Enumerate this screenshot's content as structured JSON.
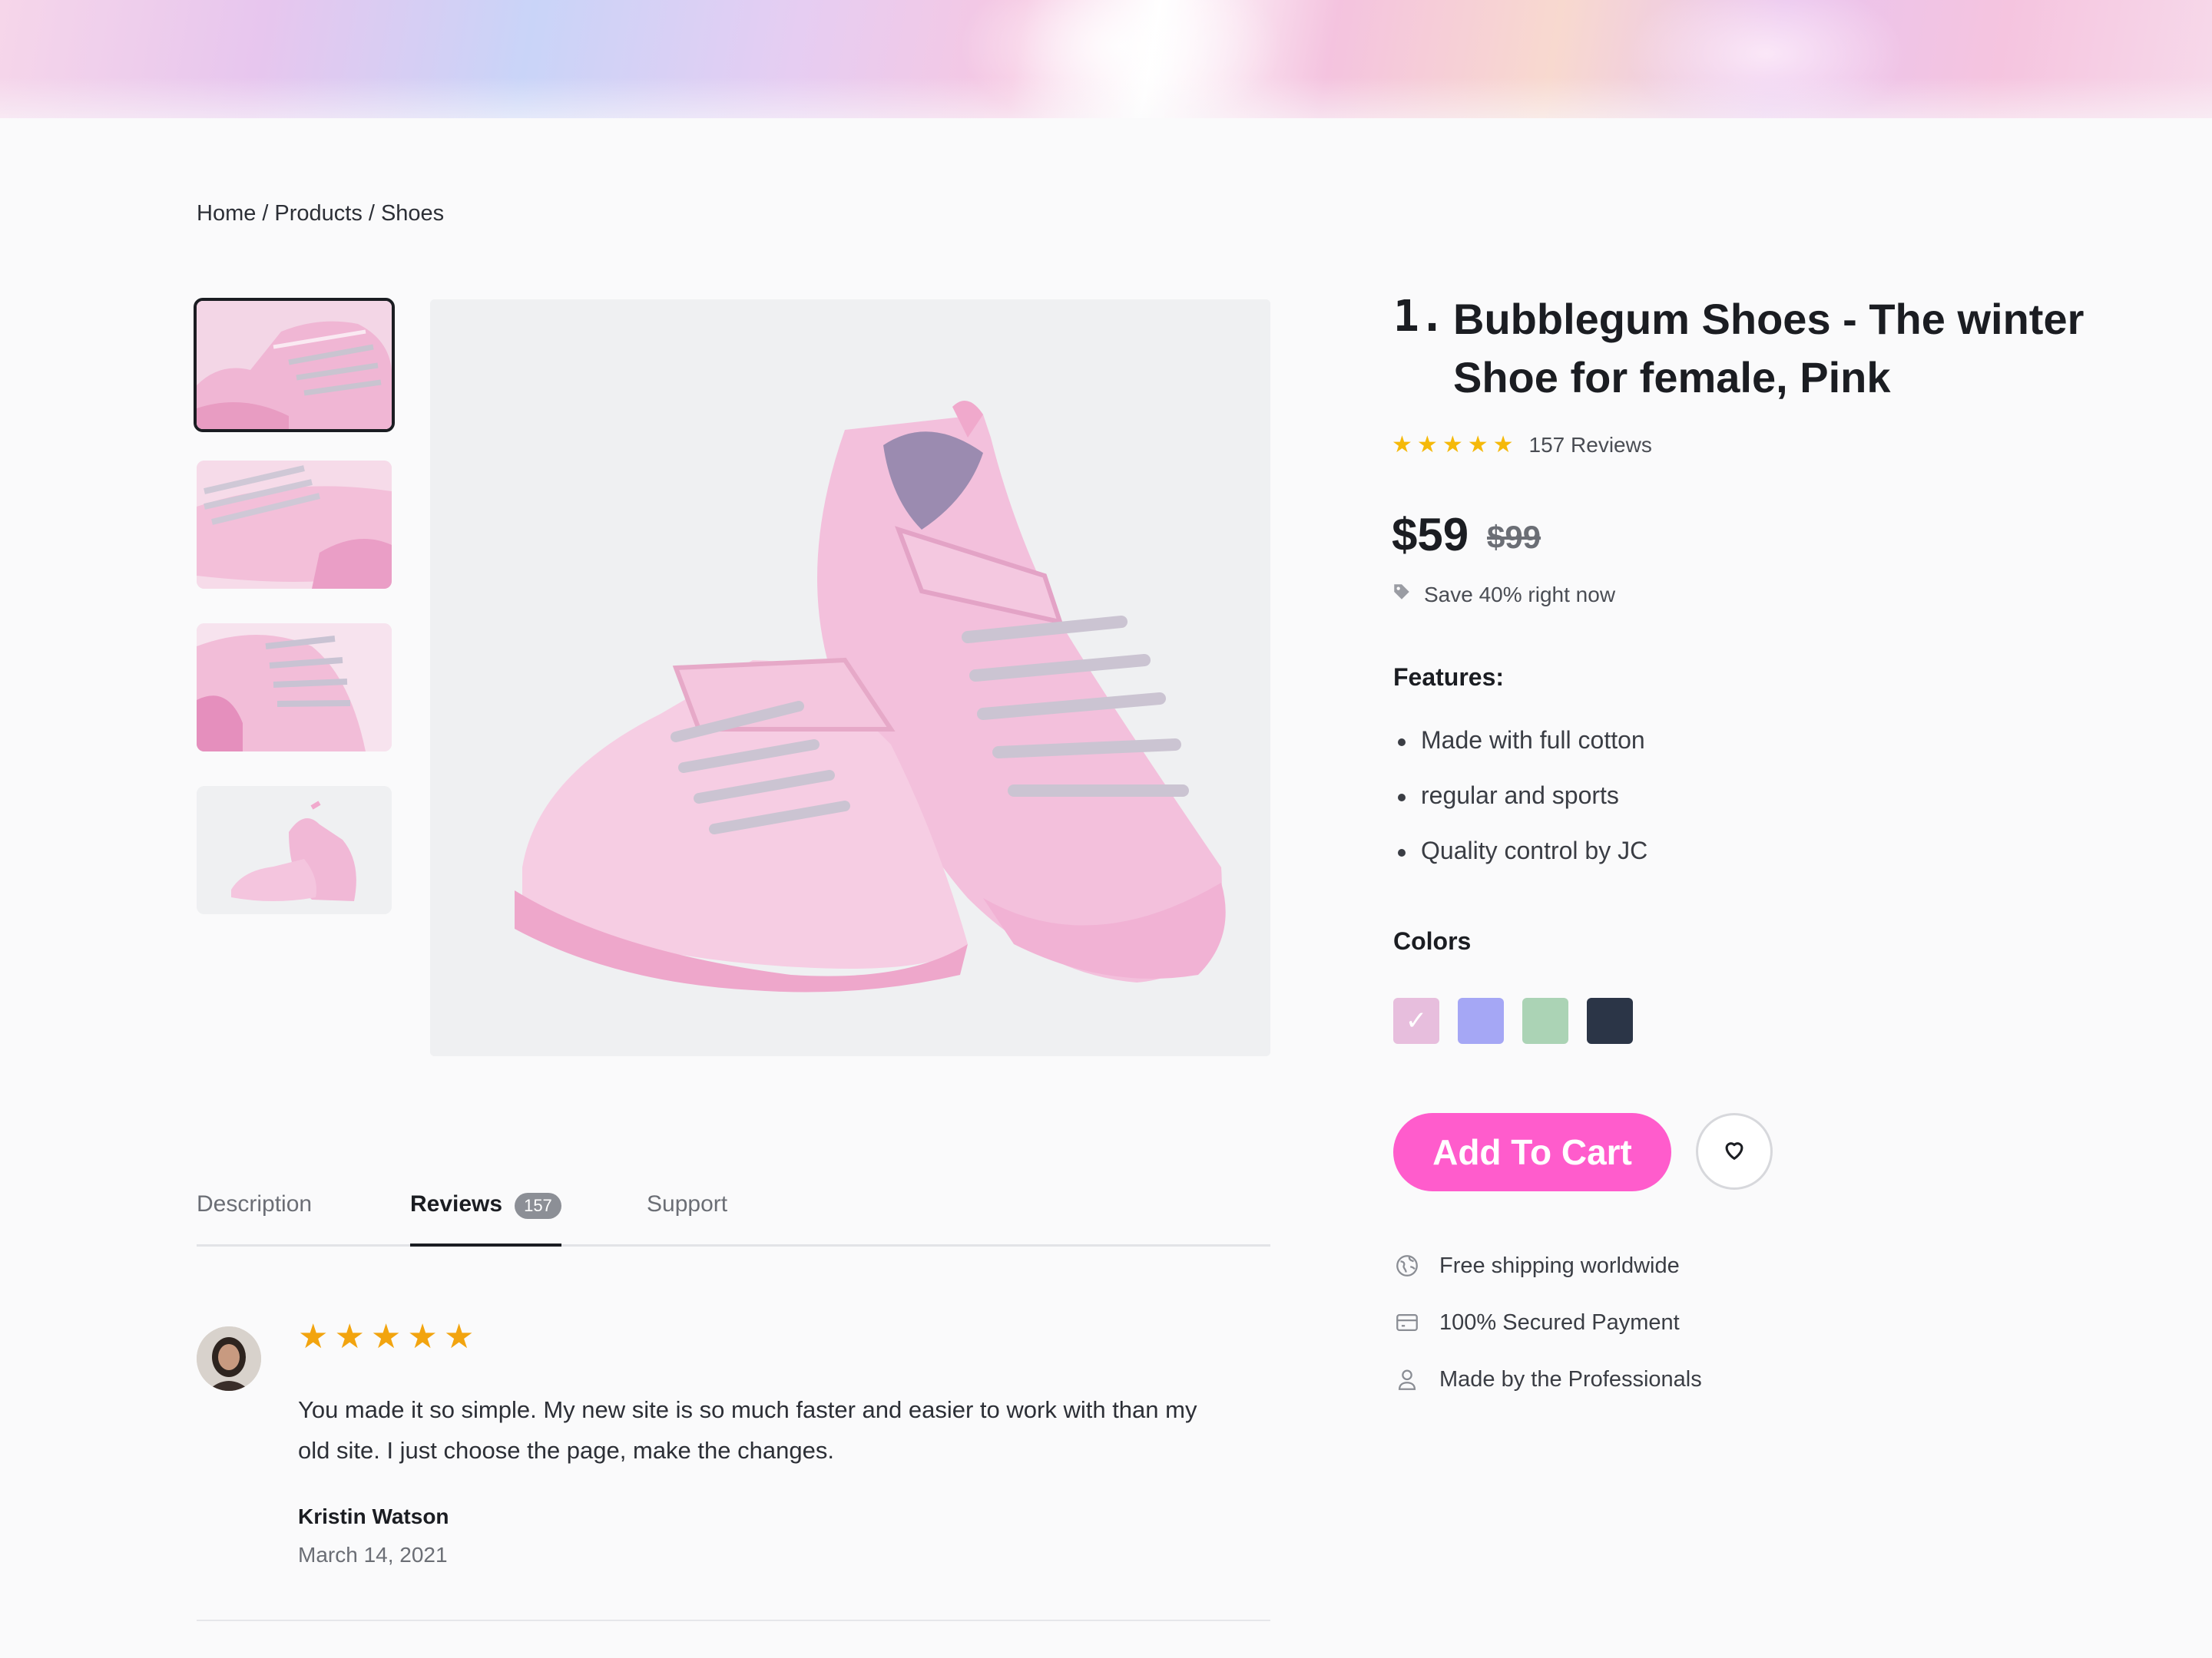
{
  "breadcrumb": [
    "Home",
    "Products",
    "Shoes"
  ],
  "product": {
    "number": "1.",
    "title": "Bubblegum Shoes - The winter Shoe for female, Pink",
    "rating_stars": 5,
    "reviews_label": "157 Reviews",
    "price": "$59",
    "old_price": "$99",
    "save_text": "Save 40% right now",
    "features_heading": "Features:",
    "features": [
      "Made with full cotton",
      "regular and sports",
      "Quality control by JC"
    ],
    "colors_heading": "Colors",
    "colors": [
      "#e7bedd",
      "#a5a7f5",
      "#abd3b5",
      "#2b3547"
    ],
    "selected_color_index": 0,
    "add_to_cart_label": "Add To Cart",
    "perks": [
      "Free shipping worldwide",
      "100% Secured Payment",
      "Made by the Professionals"
    ]
  },
  "gallery": {
    "thumbnail_count": 4,
    "active_thumbnail_index": 0
  },
  "tabs": [
    {
      "label": "Description"
    },
    {
      "label": "Reviews",
      "count": "157"
    },
    {
      "label": "Support"
    }
  ],
  "active_tab_index": 1,
  "review": {
    "stars": 5,
    "text": "You made it so simple. My new site is so much faster and easier to work with than my old site. I just choose the page, make the changes.",
    "author": "Kristin Watson",
    "date": "March 14, 2021"
  },
  "theme": {
    "accent": "#ff5ccc",
    "star_color": "#f5b90a",
    "review_star_color": "#f2a40f"
  }
}
